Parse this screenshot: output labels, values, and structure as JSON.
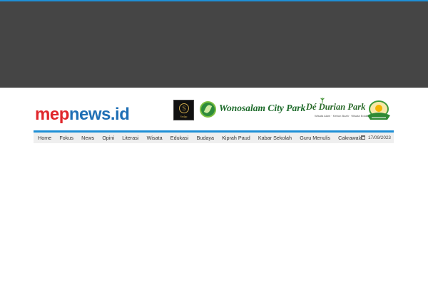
{
  "site": {
    "logo_part1": "mep",
    "logo_part2": "news.id"
  },
  "banner": {
    "sponsor1_mark": "S",
    "sponsor1_text": "Sedap",
    "sponsor2_name": "Wonosalam City Park",
    "sponsor3_name": "Dé Durian Park",
    "sponsor3_tagline": "Wisata Alam · Kebun Buah · Wisata Edukasi"
  },
  "nav": {
    "items": [
      "Home",
      "Fokus",
      "News",
      "Opini",
      "Literasi",
      "Wisata",
      "Edukasi",
      "Budaya",
      "Kiprah Paud",
      "Kabar Sekolah",
      "Guru Menulis",
      "Cakrawala"
    ],
    "date": "17/09/2023"
  },
  "colors": {
    "accent": "#1e8fd6",
    "logo_red": "#e0262b",
    "logo_blue": "#1f6fb5",
    "topband": "#454545"
  },
  "icons": {
    "date": "calendar-icon"
  }
}
